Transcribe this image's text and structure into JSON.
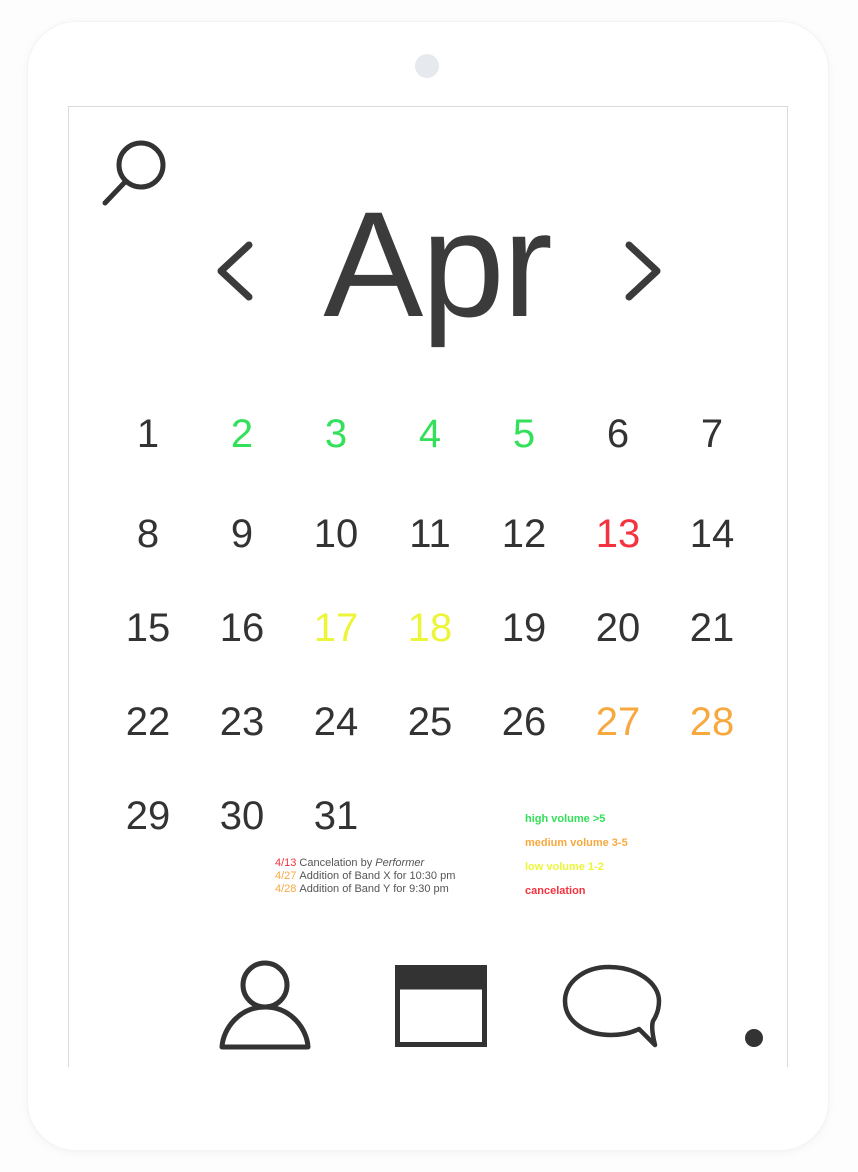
{
  "calendar": {
    "month": "Apr",
    "days": [
      {
        "label": "1",
        "color": "#333333"
      },
      {
        "label": "2",
        "color": "#33e05a"
      },
      {
        "label": "3",
        "color": "#33e05a"
      },
      {
        "label": "4",
        "color": "#33e05a"
      },
      {
        "label": "5",
        "color": "#33e05a"
      },
      {
        "label": "6",
        "color": "#333333"
      },
      {
        "label": "7",
        "color": "#333333"
      },
      {
        "label": "8",
        "color": "#333333"
      },
      {
        "label": "9",
        "color": "#333333"
      },
      {
        "label": "10",
        "color": "#333333"
      },
      {
        "label": "11",
        "color": "#333333"
      },
      {
        "label": "12",
        "color": "#333333"
      },
      {
        "label": "13",
        "color": "#f5323e"
      },
      {
        "label": "14",
        "color": "#333333"
      },
      {
        "label": "15",
        "color": "#333333"
      },
      {
        "label": "16",
        "color": "#333333"
      },
      {
        "label": "17",
        "color": "#ecf53a"
      },
      {
        "label": "18",
        "color": "#ecf53a"
      },
      {
        "label": "19",
        "color": "#333333"
      },
      {
        "label": "20",
        "color": "#333333"
      },
      {
        "label": "21",
        "color": "#333333"
      },
      {
        "label": "22",
        "color": "#333333"
      },
      {
        "label": "23",
        "color": "#333333"
      },
      {
        "label": "24",
        "color": "#333333"
      },
      {
        "label": "25",
        "color": "#333333"
      },
      {
        "label": "26",
        "color": "#333333"
      },
      {
        "label": "27",
        "color": "#f7a940"
      },
      {
        "label": "28",
        "color": "#f7a940"
      },
      {
        "label": "29",
        "color": "#333333"
      },
      {
        "label": "30",
        "color": "#333333"
      },
      {
        "label": "31",
        "color": "#333333"
      }
    ]
  },
  "notes": [
    {
      "date": "4/13",
      "text": "Cancelation by ",
      "emphasis": "Performer",
      "date_color": "#f5323e"
    },
    {
      "date": "4/27",
      "text": "Addition of Band X for 10:30 pm",
      "emphasis": "",
      "date_color": "#f7a940"
    },
    {
      "date": "4/28",
      "text": "Addition of Band Y for 9:30 pm",
      "emphasis": "",
      "date_color": "#f7a940"
    }
  ],
  "legend": [
    {
      "label": "high volume >5",
      "color": "#33e05a"
    },
    {
      "label": "medium volume 3-5",
      "color": "#f7a940"
    },
    {
      "label": "low volume 1-2",
      "color": "#ecf53a"
    },
    {
      "label": "cancelation",
      "color": "#f5323e"
    }
  ],
  "icons": {
    "search": "search-icon",
    "prev": "chevron-left-icon",
    "next": "chevron-right-icon",
    "profile": "user-icon",
    "calendar": "calendar-icon",
    "chat": "chat-bubble-icon"
  },
  "colors": {
    "text": "#333333",
    "high": "#33e05a",
    "medium": "#f7a940",
    "low": "#ecf53a",
    "cancel": "#f5323e"
  }
}
